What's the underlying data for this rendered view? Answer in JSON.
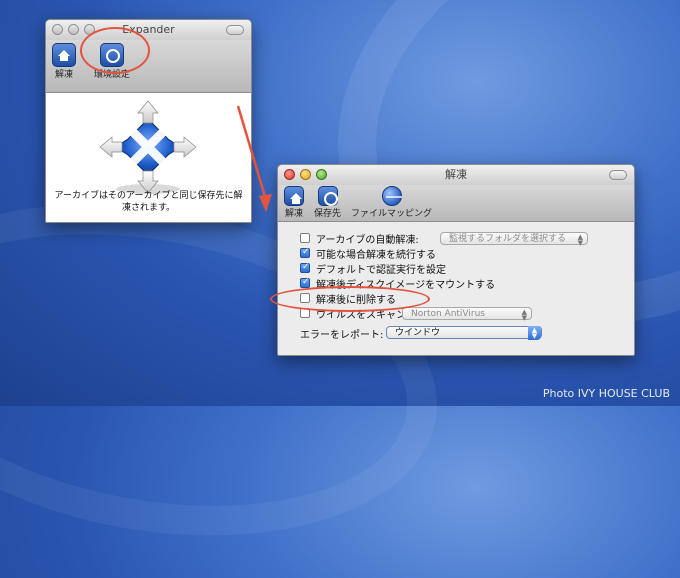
{
  "expander_window": {
    "title": "Expander",
    "toolbar": [
      {
        "label": "解凍",
        "icon": "home-icon"
      },
      {
        "label": "環境設定",
        "icon": "settings-icon"
      }
    ],
    "caption": "アーカイブはそのアーカイブと同じ保存先に解凍されます。"
  },
  "settings_window": {
    "title": "解凍",
    "toolbar": [
      {
        "label": "解凍",
        "icon": "home-icon"
      },
      {
        "label": "保存先",
        "icon": "settings-icon"
      },
      {
        "label": "ファイルマッピング",
        "icon": "globe-icon"
      }
    ],
    "options": [
      {
        "label": "アーカイブの自動解凍:",
        "checked": false
      },
      {
        "label": "可能な場合解凍を続行する",
        "checked": true
      },
      {
        "label": "デフォルトで認証実行を設定",
        "checked": true
      },
      {
        "label": "解凍後ディスクイメージをマウントする",
        "checked": true
      },
      {
        "label": "解凍後に削除する",
        "checked": false
      },
      {
        "label": "ウイルスをスキャン:",
        "checked": false
      }
    ],
    "auto_expand_popup": "監視するフォルダを選択する",
    "antivirus_popup": "Norton AntiVirus",
    "error_label": "エラーをレポート:",
    "error_popup": "ウインドウ"
  },
  "annotations": {
    "color": "#e5533f"
  },
  "credit": "Photo IVY HOUSE CLUB"
}
